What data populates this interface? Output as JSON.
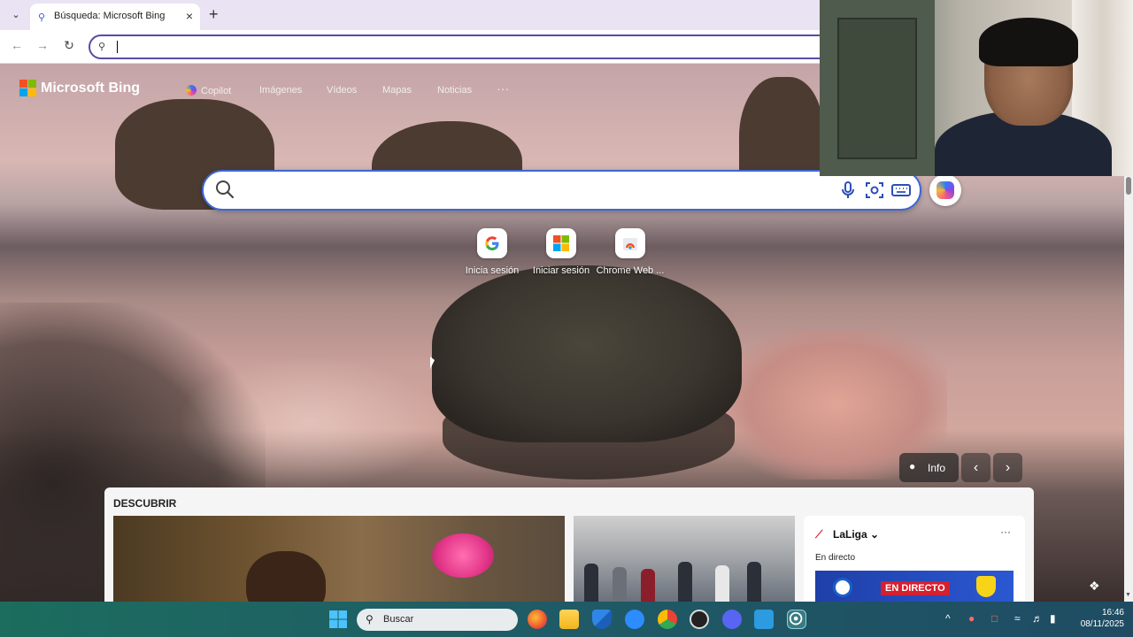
{
  "browser": {
    "tab_title": "Búsqueda: Microsoft Bing",
    "omnibox_value": ""
  },
  "bing": {
    "brand": "Microsoft Bing",
    "nav": [
      "Copilot",
      "Imágenes",
      "Vídeos",
      "Mapas",
      "Noticias",
      "···"
    ],
    "shortcuts": [
      "Inicia sesión",
      "Iniciar sesión",
      "Chrome Web ..."
    ],
    "info_label": "Info",
    "discover": {
      "title": "DESCUBRIR",
      "card_c": {
        "title": "LaLiga",
        "subtitle": "En directo",
        "live_badge": "EN DIRECTO"
      }
    }
  },
  "taskbar": {
    "search_label": "Buscar",
    "time": "16:46",
    "date": "08/11/2025"
  },
  "colors": {
    "accent_blue": "#3b67d6",
    "tab_bar": "#e9e3f3",
    "live_red": "#d4202f"
  }
}
